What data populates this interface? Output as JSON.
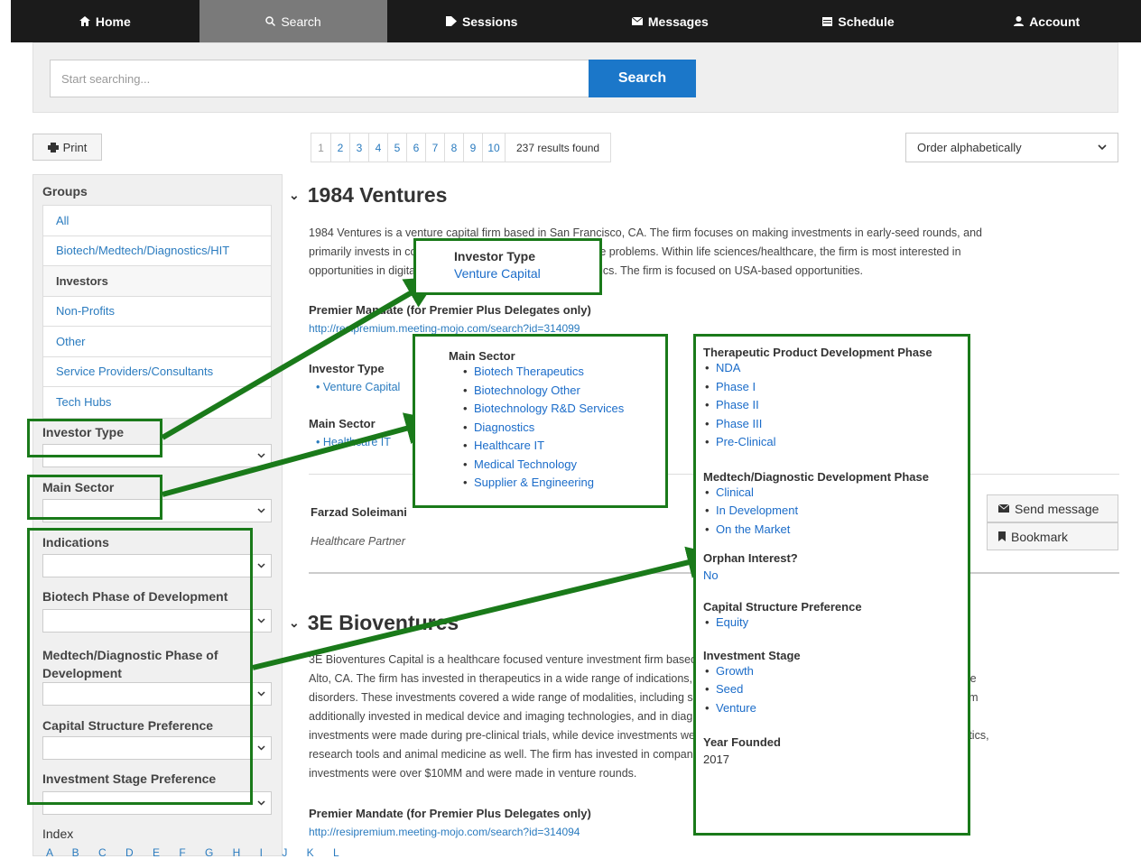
{
  "nav": {
    "items": [
      {
        "label": "Home",
        "icon": "home-icon"
      },
      {
        "label": "Search",
        "icon": "search-icon"
      },
      {
        "label": "Sessions",
        "icon": "tag-icon"
      },
      {
        "label": "Messages",
        "icon": "envelope-icon"
      },
      {
        "label": "Schedule",
        "icon": "calendar-icon"
      },
      {
        "label": "Account",
        "icon": "user-icon"
      }
    ],
    "active": "Search"
  },
  "search": {
    "placeholder": "Start searching...",
    "button": "Search"
  },
  "toolbar": {
    "print_label": "Print",
    "pages": [
      "1",
      "2",
      "3",
      "4",
      "5",
      "6",
      "7",
      "8",
      "9",
      "10"
    ],
    "results_count": "237 results found",
    "order_value": "Order alphabetically"
  },
  "sidebar": {
    "groups_heading": "Groups",
    "groups": [
      "All",
      "Biotech/Medtech/Diagnostics/HIT",
      "Investors",
      "Non-Profits",
      "Other",
      "Service Providers/Consultants",
      "Tech Hubs"
    ],
    "active_group": "Investors",
    "filters": {
      "investor_type": "Investor Type",
      "main_sector": "Main Sector",
      "indications": "Indications",
      "biotech_phase": "Biotech Phase of Development",
      "medtech_phase_line1": "Medtech/Diagnostic Phase of",
      "medtech_phase_line2": "Development",
      "capital_structure": "Capital Structure Preference",
      "investment_stage": "Investment Stage Preference"
    },
    "index_heading": "Index",
    "index_letters": "A B C D E F G H I J K L"
  },
  "results": [
    {
      "name": "1984 Ventures",
      "desc_line1": "1984 Ventures is a venture capital firm based in San Francisco, CA. The firm focuses on making investments in early-seed rounds, and",
      "desc_line2": "primarily invests in companies that address large worldwide problems. Within life sciences/healthcare, the firm is most interested in",
      "desc_line3": "opportunities in digital health, diagnostics and/or therapeutics. The firm is focused on USA-based opportunities.",
      "mandate_label": "Premier Mandate (for Premier Plus Delegates only)",
      "mandate_link": "http://resipremium.meeting-mojo.com/search?id=314099",
      "investor_type_label": "Investor Type",
      "investor_type_value": "Venture Capital",
      "main_sector_label": "Main Sector",
      "main_sector_value": "Healthcare IT",
      "contact_name": "Farzad Soleimani",
      "contact_role": "Healthcare Partner",
      "send_message": "Send message",
      "bookmark": "Bookmark"
    },
    {
      "name": "3E Bioventures",
      "desc_line1": "3E Bioventures Capital is a healthcare focused venture investment firm based in Shanghai, China, with an additional office in Palo",
      "desc_line2": "Alto, CA. The firm has invested in therapeutics in a wide range of indications, including oncology, infectious diseases and autoimmune",
      "desc_line3": "disorders. These investments covered a wide range of modalities, including small molecules, biologics and vaccine therapies. The firm",
      "desc_line4": "additionally invested in medical device and imaging technologies, and in diagnostics and precision medicine areas. Therapeutic",
      "desc_line5": "investments were made during pre-clinical trials, while device investments were in clinical stage. The firm also invested in bioinformatics,",
      "desc_line6": "research tools and animal medicine as well. The firm has invested in companies based in the USA, China and Europe. These",
      "desc_line7": "investments were over $10MM and were made in venture rounds.",
      "mandate_label": "Premier Mandate (for Premier Plus Delegates only)",
      "mandate_link": "http://resipremium.meeting-mojo.com/search?id=314094"
    }
  ],
  "callouts": {
    "investor_type": {
      "title": "Investor Type",
      "value": "Venture Capital"
    },
    "main_sector": {
      "title": "Main Sector",
      "items": [
        "Biotech Therapeutics",
        "Biotechnology Other",
        "Biotechnology R&D Services",
        "Diagnostics",
        "Healthcare IT",
        "Medical Technology",
        "Supplier & Engineering"
      ]
    },
    "phases": {
      "therapeutic_title": "Therapeutic Product Development Phase",
      "therapeutic_items": [
        "NDA",
        "Phase I",
        "Phase II",
        "Phase III",
        "Pre-Clinical"
      ],
      "medtech_title": "Medtech/Diagnostic Development Phase",
      "medtech_items": [
        "Clinical",
        "In Development",
        "On the Market"
      ],
      "orphan_title": "Orphan Interest?",
      "orphan_value": "No",
      "capital_title": "Capital Structure Preference",
      "capital_items": [
        "Equity"
      ],
      "stage_title": "Investment Stage",
      "stage_items": [
        "Growth",
        "Seed",
        "Venture"
      ],
      "year_title": "Year Founded",
      "year_value": "2017"
    }
  },
  "colors": {
    "nav_bg": "#1b1b1b",
    "accent": "#1b77c9",
    "callout_border": "#1a7a1a",
    "link": "#2a7bbf"
  }
}
